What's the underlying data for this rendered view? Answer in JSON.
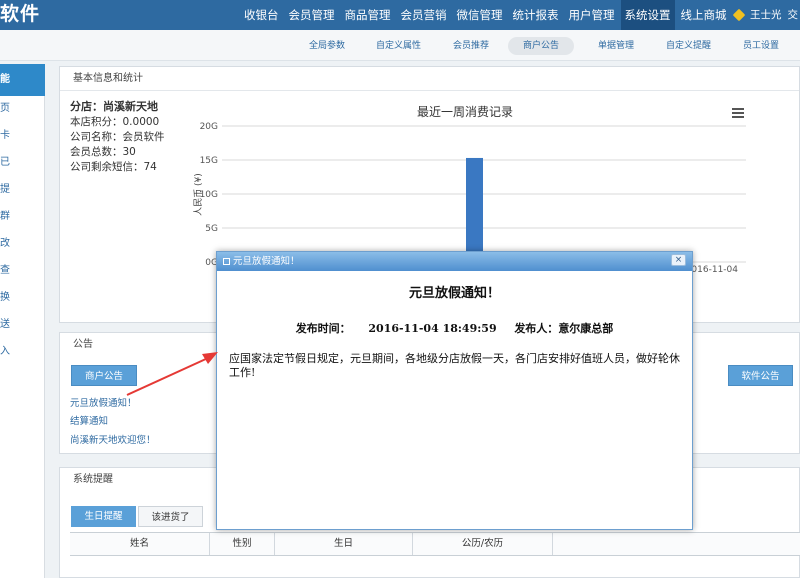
{
  "app": {
    "logo": "软件"
  },
  "topnav": [
    {
      "label": "收银台"
    },
    {
      "label": "会员管理"
    },
    {
      "label": "商品管理"
    },
    {
      "label": "会员营销"
    },
    {
      "label": "微信管理"
    },
    {
      "label": "统计报表"
    },
    {
      "label": "用户管理"
    },
    {
      "label": "系统设置",
      "active": true
    },
    {
      "label": "线上商城"
    }
  ],
  "user": {
    "name": "王士光",
    "extra": "交"
  },
  "subnav": [
    {
      "label": "全局参数"
    },
    {
      "label": "自定义属性"
    },
    {
      "label": "会员推荐"
    },
    {
      "label": "商户公告",
      "active": true
    },
    {
      "label": "单据管理"
    },
    {
      "label": "自定义提醒"
    },
    {
      "label": "员工设置"
    }
  ],
  "sidebar": [
    {
      "label": "能",
      "active": true
    },
    {
      "label": "页"
    },
    {
      "label": "卡"
    },
    {
      "label": "已"
    },
    {
      "label": "提"
    },
    {
      "label": "群"
    },
    {
      "label": "改"
    },
    {
      "label": "查"
    },
    {
      "label": "换"
    },
    {
      "label": "送"
    },
    {
      "label": "入"
    }
  ],
  "basic": {
    "title": "基本信息和统计",
    "shop": "分店：尚溪新天地",
    "points": "本店积分：0.0000",
    "company": "公司名称：会员软件",
    "members": "会员总数：30",
    "sms": "公司剩余短信：74"
  },
  "chart_data": {
    "type": "bar",
    "title": "最近一周消费记录",
    "ylabel": "人民币 (¥)",
    "ylim": [
      0,
      20
    ],
    "yticks": [
      "0G",
      "5G",
      "10G",
      "15G",
      "20G"
    ],
    "categories": [
      "2016-11-04"
    ],
    "values": [
      15.3
    ],
    "grid": true,
    "color": "#3a78c2"
  },
  "notice": {
    "title": "公告",
    "merchant_btn": "商户公告",
    "software_btn": "软件公告",
    "links": [
      "元旦放假通知！",
      "结算通知",
      "尚溪新天地欢迎您！"
    ]
  },
  "reminder": {
    "title": "系统提醒",
    "tabs": [
      "生日提醒",
      "该进货了"
    ],
    "columns": [
      "姓名",
      "性别",
      "生日",
      "公历/农历"
    ]
  },
  "modal": {
    "bar_title": "元旦放假通知！",
    "close": "×",
    "heading": "元旦放假通知！",
    "time_label": "发布时间：",
    "time_value": "2016-11-04 18:49:59",
    "author_label": "发布人：",
    "author_value": "意尔康总部",
    "body": "应国家法定节假日规定，元旦期间，各地级分店放假一天，各门店安排好值班人员，做好轮休工作!"
  },
  "colors": {
    "primary": "#2e6aa1",
    "accent": "#5aa0d8",
    "arrow": "#e53935"
  }
}
